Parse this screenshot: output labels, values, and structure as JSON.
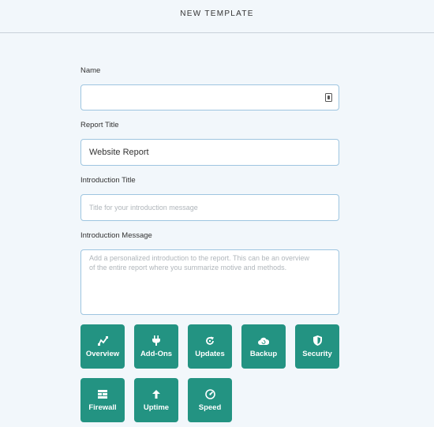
{
  "header": {
    "title": "NEW TEMPLATE"
  },
  "form": {
    "name": {
      "label": "Name",
      "value": "",
      "icon": "contact-card-icon"
    },
    "report_title": {
      "label": "Report Title",
      "value": "Website Report"
    },
    "intro_title": {
      "label": "Introduction Title",
      "placeholder": "Title for your introduction message"
    },
    "intro_message": {
      "label": "Introduction Message",
      "placeholder_line1": "Add a personalized introduction to the report. This can be an overview",
      "placeholder_line2": "of the entire report where you summarize motive and methods."
    }
  },
  "tiles": [
    {
      "label": "Overview",
      "icon": "chart-icon"
    },
    {
      "label": "Add-Ons",
      "icon": "plug-icon"
    },
    {
      "label": "Updates",
      "icon": "refresh-icon"
    },
    {
      "label": "Backup",
      "icon": "cloud-icon"
    },
    {
      "label": "Security",
      "icon": "shield-icon"
    },
    {
      "label": "Firewall",
      "icon": "firewall-icon"
    },
    {
      "label": "Uptime",
      "icon": "arrow-up-icon"
    },
    {
      "label": "Speed",
      "icon": "speedometer-icon"
    }
  ],
  "colors": {
    "accent": "#239382",
    "border": "#9ec5e0",
    "background": "#f2f7fb"
  }
}
